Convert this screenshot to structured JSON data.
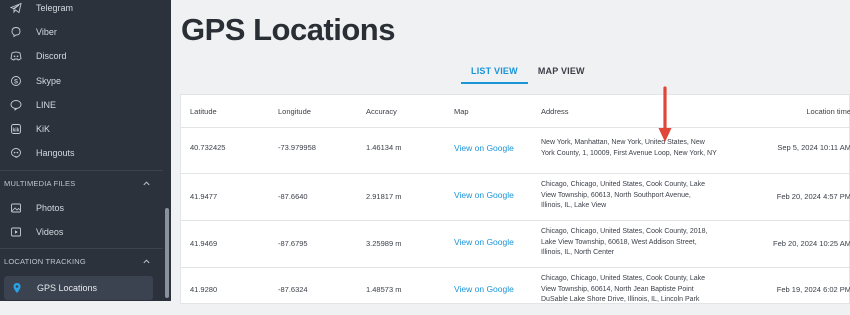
{
  "sidebar": {
    "apps": [
      {
        "label": "Telegram",
        "icon": "telegram-icon"
      },
      {
        "label": "Viber",
        "icon": "viber-icon"
      },
      {
        "label": "Discord",
        "icon": "discord-icon"
      },
      {
        "label": "Skype",
        "icon": "skype-icon"
      },
      {
        "label": "LINE",
        "icon": "line-icon"
      },
      {
        "label": "KiK",
        "icon": "kik-icon"
      },
      {
        "label": "Hangouts",
        "icon": "hangouts-icon"
      }
    ],
    "multimedia_header": "MULTIMEDIA FILES",
    "multimedia": [
      {
        "label": "Photos",
        "icon": "photo-icon"
      },
      {
        "label": "Videos",
        "icon": "video-icon"
      }
    ],
    "location_header": "LOCATION TRACKING",
    "location": [
      {
        "label": "GPS Locations",
        "icon": "location-pin-icon",
        "active": true
      }
    ]
  },
  "main": {
    "title": "GPS Locations",
    "tabs": [
      {
        "label": "LIST VIEW",
        "active": true
      },
      {
        "label": "MAP VIEW",
        "active": false
      }
    ],
    "table": {
      "headers": [
        "Latitude",
        "Longitude",
        "Accuracy",
        "Map",
        "Address",
        "Location time"
      ],
      "rows": [
        {
          "lat": "40.732425",
          "lon": "-73.979958",
          "acc": "1.46134 m",
          "map": "View on Google",
          "addr1": "New York, Manhattan, New York, United States, New",
          "addr2": "York County, 1, 10009, First Avenue Loop, New York, NY",
          "addr3": "",
          "time": "Sep 5, 2024 10:11 AM"
        },
        {
          "lat": "41.9477",
          "lon": "-87.6640",
          "acc": "2.91817 m",
          "map": "View on Google",
          "addr1": "Chicago, Chicago, United States, Cook County, Lake",
          "addr2": "View Township, 60613, North Southport Avenue,",
          "addr3": "Illinois, IL, Lake View",
          "time": "Feb 20, 2024 4:57 PM"
        },
        {
          "lat": "41.9469",
          "lon": "-87.6795",
          "acc": "3.25989 m",
          "map": "View on Google",
          "addr1": "Chicago, Chicago, United States, Cook County, 2018,",
          "addr2": "Lake View Township, 60618, West Addison Street,",
          "addr3": "Illinois, IL, North Center",
          "time": "Feb 20, 2024 10:25 AM"
        },
        {
          "lat": "41.9280",
          "lon": "-87.6324",
          "acc": "1.48573 m",
          "map": "View on Google",
          "addr1": "Chicago, Chicago, United States, Cook County, Lake",
          "addr2": "View Township, 60614, North Jean Baptiste Point",
          "addr3": "DuSable Lake Shore Drive, Illinois, IL, Lincoln Park",
          "time": "Feb 19, 2024 6:02 PM"
        }
      ]
    }
  },
  "colors": {
    "accent": "#1b95d8",
    "sidebar_bg": "#2c323c",
    "arrow": "#e0473a"
  }
}
